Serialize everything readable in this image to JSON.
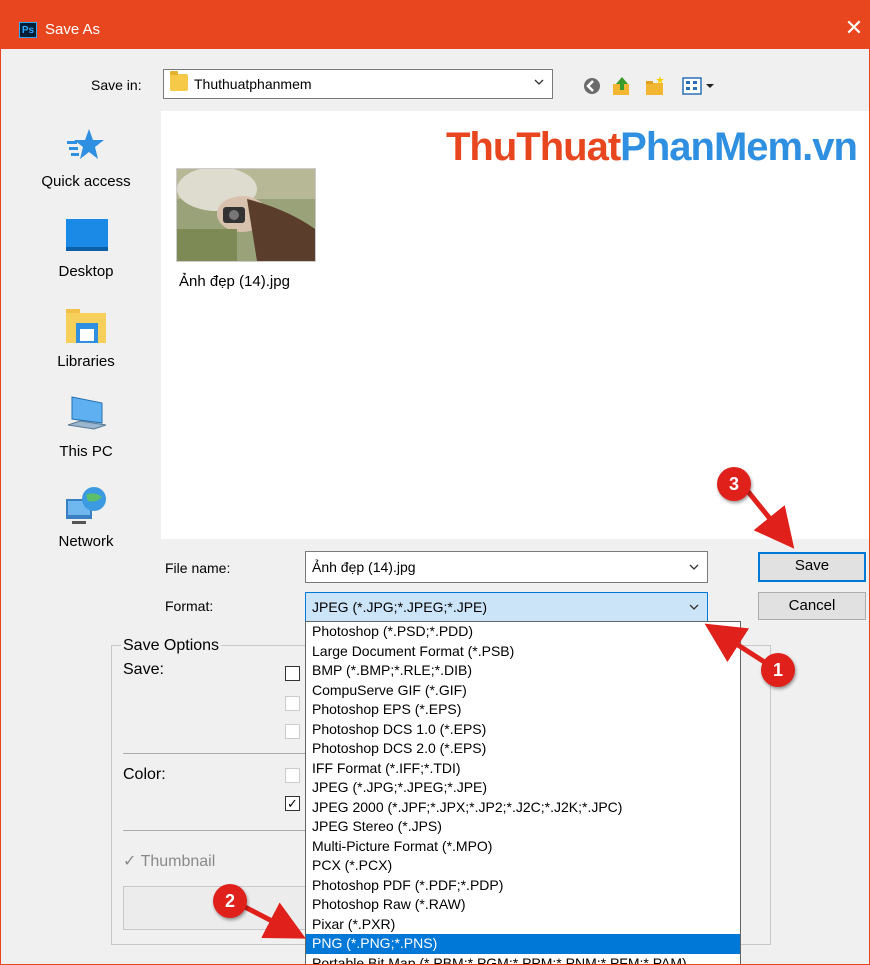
{
  "window": {
    "title": "Save As",
    "app_icon": "Ps"
  },
  "toolbar": {
    "save_in_label": "Save in:",
    "save_in_value": "Thuthuatphanmem",
    "icons": [
      "back-icon",
      "up-folder-icon",
      "new-folder-icon",
      "view-menu-icon"
    ]
  },
  "places": [
    {
      "label": "Quick access",
      "icon": "quick-access-star-icon"
    },
    {
      "label": "Desktop",
      "icon": "desktop-icon"
    },
    {
      "label": "Libraries",
      "icon": "libraries-icon"
    },
    {
      "label": "This PC",
      "icon": "this-pc-icon"
    },
    {
      "label": "Network",
      "icon": "network-icon"
    }
  ],
  "watermark": {
    "part1": "ThuThuat",
    "part2": "PhanMem",
    "part3": ".vn"
  },
  "files": [
    {
      "name": "Ảnh đẹp (14).jpg"
    }
  ],
  "form": {
    "file_name_label": "File name:",
    "file_name_value": "Ảnh đẹp (14).jpg",
    "format_label": "Format:",
    "format_value": "JPEG (*.JPG;*.JPEG;*.JPE)",
    "save_button": "Save",
    "cancel_button": "Cancel"
  },
  "format_options": [
    "Photoshop (*.PSD;*.PDD)",
    "Large Document Format (*.PSB)",
    "BMP (*.BMP;*.RLE;*.DIB)",
    "CompuServe GIF (*.GIF)",
    "Photoshop EPS (*.EPS)",
    "Photoshop DCS 1.0 (*.EPS)",
    "Photoshop DCS 2.0 (*.EPS)",
    "IFF Format (*.IFF;*.TDI)",
    "JPEG (*.JPG;*.JPEG;*.JPE)",
    "JPEG 2000 (*.JPF;*.JPX;*.JP2;*.J2C;*.J2K;*.JPC)",
    "JPEG Stereo (*.JPS)",
    "Multi-Picture Format (*.MPO)",
    "PCX (*.PCX)",
    "Photoshop PDF (*.PDF;*.PDP)",
    "Photoshop Raw (*.RAW)",
    "Pixar (*.PXR)",
    "PNG (*.PNG;*.PNS)",
    "Portable Bit Map (*.PBM;*.PGM;*.PPM;*.PNM;*.PFM;*.PAM)"
  ],
  "selected_format_index": 16,
  "save_options": {
    "group_label": "Save Options",
    "save_label": "Save:",
    "color_label": "Color:",
    "thumbnail_label": "Thumbnail",
    "thumbnail_checked": true
  },
  "annotations": [
    "1",
    "2",
    "3"
  ],
  "colors": {
    "title_bar": "#e8461f",
    "selection": "#0078d7",
    "badge": "#e0201b",
    "arrow": "#e0201b"
  }
}
